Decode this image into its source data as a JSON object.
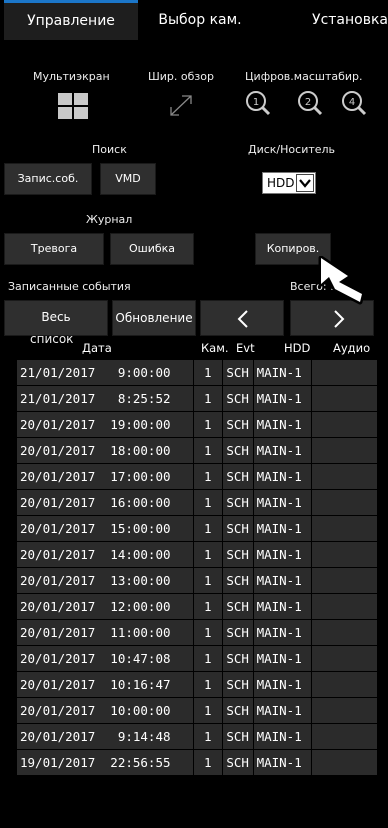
{
  "tabs": [
    "Управление",
    "Выбор кам.",
    "Установка"
  ],
  "panel": {
    "multiscreen": "Мультиэкран",
    "wide_view": "Шир. обзор",
    "digital_zoom": "Цифров.масштабир.",
    "zoom_levels": [
      "×1",
      "×2",
      "×4"
    ],
    "search": "Поиск",
    "disk": "Диск/Носитель",
    "rec_events_btn": "Запис.соб.",
    "vmd_btn": "VMD",
    "disk_select": "HDD",
    "journal": "Журнал",
    "alarm_btn": "Тревога",
    "error_btn": "Ошибка",
    "copy_btn": "Копиров.",
    "recorded_events": "Записанные события",
    "total": "Всего: 9",
    "all_list_btn": "Весь",
    "list_caption": "список",
    "refresh_btn": "Обновление",
    "prev": "<",
    "next": ">"
  },
  "table": {
    "headers": [
      "Дата",
      "Кам.",
      "Evt",
      "HDD",
      "Аудио"
    ],
    "rows": [
      [
        "21/01/2017   9:00:00",
        "1",
        "SCH",
        "MAIN-1",
        ""
      ],
      [
        "21/01/2017   8:25:52",
        "1",
        "SCH",
        "MAIN-1",
        ""
      ],
      [
        "20/01/2017  19:00:00",
        "1",
        "SCH",
        "MAIN-1",
        ""
      ],
      [
        "20/01/2017  18:00:00",
        "1",
        "SCH",
        "MAIN-1",
        ""
      ],
      [
        "20/01/2017  17:00:00",
        "1",
        "SCH",
        "MAIN-1",
        ""
      ],
      [
        "20/01/2017  16:00:00",
        "1",
        "SCH",
        "MAIN-1",
        ""
      ],
      [
        "20/01/2017  15:00:00",
        "1",
        "SCH",
        "MAIN-1",
        ""
      ],
      [
        "20/01/2017  14:00:00",
        "1",
        "SCH",
        "MAIN-1",
        ""
      ],
      [
        "20/01/2017  13:00:00",
        "1",
        "SCH",
        "MAIN-1",
        ""
      ],
      [
        "20/01/2017  12:00:00",
        "1",
        "SCH",
        "MAIN-1",
        ""
      ],
      [
        "20/01/2017  11:00:00",
        "1",
        "SCH",
        "MAIN-1",
        ""
      ],
      [
        "20/01/2017  10:47:08",
        "1",
        "SCH",
        "MAIN-1",
        ""
      ],
      [
        "20/01/2017  10:16:47",
        "1",
        "SCH",
        "MAIN-1",
        ""
      ],
      [
        "20/01/2017  10:00:00",
        "1",
        "SCH",
        "MAIN-1",
        ""
      ],
      [
        "20/01/2017   9:14:48",
        "1",
        "SCH",
        "MAIN-1",
        ""
      ],
      [
        "19/01/2017  22:56:55",
        "1",
        "SCH",
        "MAIN-1",
        ""
      ]
    ]
  }
}
